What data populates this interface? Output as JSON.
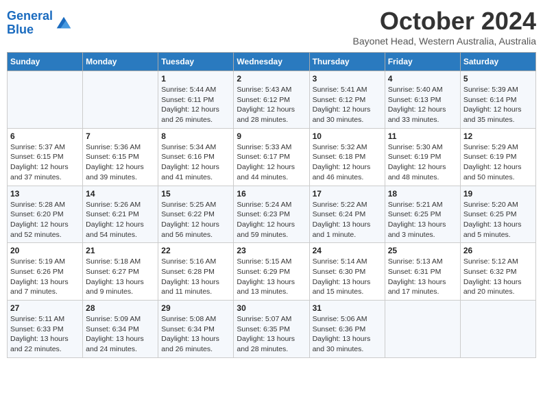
{
  "logo": {
    "line1": "General",
    "line2": "Blue"
  },
  "title": "October 2024",
  "location": "Bayonet Head, Western Australia, Australia",
  "weekdays": [
    "Sunday",
    "Monday",
    "Tuesday",
    "Wednesday",
    "Thursday",
    "Friday",
    "Saturday"
  ],
  "weeks": [
    [
      {
        "day": null,
        "info": null
      },
      {
        "day": null,
        "info": null
      },
      {
        "day": "1",
        "info": "Sunrise: 5:44 AM\nSunset: 6:11 PM\nDaylight: 12 hours and 26 minutes."
      },
      {
        "day": "2",
        "info": "Sunrise: 5:43 AM\nSunset: 6:12 PM\nDaylight: 12 hours and 28 minutes."
      },
      {
        "day": "3",
        "info": "Sunrise: 5:41 AM\nSunset: 6:12 PM\nDaylight: 12 hours and 30 minutes."
      },
      {
        "day": "4",
        "info": "Sunrise: 5:40 AM\nSunset: 6:13 PM\nDaylight: 12 hours and 33 minutes."
      },
      {
        "day": "5",
        "info": "Sunrise: 5:39 AM\nSunset: 6:14 PM\nDaylight: 12 hours and 35 minutes."
      }
    ],
    [
      {
        "day": "6",
        "info": "Sunrise: 5:37 AM\nSunset: 6:15 PM\nDaylight: 12 hours and 37 minutes."
      },
      {
        "day": "7",
        "info": "Sunrise: 5:36 AM\nSunset: 6:15 PM\nDaylight: 12 hours and 39 minutes."
      },
      {
        "day": "8",
        "info": "Sunrise: 5:34 AM\nSunset: 6:16 PM\nDaylight: 12 hours and 41 minutes."
      },
      {
        "day": "9",
        "info": "Sunrise: 5:33 AM\nSunset: 6:17 PM\nDaylight: 12 hours and 44 minutes."
      },
      {
        "day": "10",
        "info": "Sunrise: 5:32 AM\nSunset: 6:18 PM\nDaylight: 12 hours and 46 minutes."
      },
      {
        "day": "11",
        "info": "Sunrise: 5:30 AM\nSunset: 6:19 PM\nDaylight: 12 hours and 48 minutes."
      },
      {
        "day": "12",
        "info": "Sunrise: 5:29 AM\nSunset: 6:19 PM\nDaylight: 12 hours and 50 minutes."
      }
    ],
    [
      {
        "day": "13",
        "info": "Sunrise: 5:28 AM\nSunset: 6:20 PM\nDaylight: 12 hours and 52 minutes."
      },
      {
        "day": "14",
        "info": "Sunrise: 5:26 AM\nSunset: 6:21 PM\nDaylight: 12 hours and 54 minutes."
      },
      {
        "day": "15",
        "info": "Sunrise: 5:25 AM\nSunset: 6:22 PM\nDaylight: 12 hours and 56 minutes."
      },
      {
        "day": "16",
        "info": "Sunrise: 5:24 AM\nSunset: 6:23 PM\nDaylight: 12 hours and 59 minutes."
      },
      {
        "day": "17",
        "info": "Sunrise: 5:22 AM\nSunset: 6:24 PM\nDaylight: 13 hours and 1 minute."
      },
      {
        "day": "18",
        "info": "Sunrise: 5:21 AM\nSunset: 6:25 PM\nDaylight: 13 hours and 3 minutes."
      },
      {
        "day": "19",
        "info": "Sunrise: 5:20 AM\nSunset: 6:25 PM\nDaylight: 13 hours and 5 minutes."
      }
    ],
    [
      {
        "day": "20",
        "info": "Sunrise: 5:19 AM\nSunset: 6:26 PM\nDaylight: 13 hours and 7 minutes."
      },
      {
        "day": "21",
        "info": "Sunrise: 5:18 AM\nSunset: 6:27 PM\nDaylight: 13 hours and 9 minutes."
      },
      {
        "day": "22",
        "info": "Sunrise: 5:16 AM\nSunset: 6:28 PM\nDaylight: 13 hours and 11 minutes."
      },
      {
        "day": "23",
        "info": "Sunrise: 5:15 AM\nSunset: 6:29 PM\nDaylight: 13 hours and 13 minutes."
      },
      {
        "day": "24",
        "info": "Sunrise: 5:14 AM\nSunset: 6:30 PM\nDaylight: 13 hours and 15 minutes."
      },
      {
        "day": "25",
        "info": "Sunrise: 5:13 AM\nSunset: 6:31 PM\nDaylight: 13 hours and 17 minutes."
      },
      {
        "day": "26",
        "info": "Sunrise: 5:12 AM\nSunset: 6:32 PM\nDaylight: 13 hours and 20 minutes."
      }
    ],
    [
      {
        "day": "27",
        "info": "Sunrise: 5:11 AM\nSunset: 6:33 PM\nDaylight: 13 hours and 22 minutes."
      },
      {
        "day": "28",
        "info": "Sunrise: 5:09 AM\nSunset: 6:34 PM\nDaylight: 13 hours and 24 minutes."
      },
      {
        "day": "29",
        "info": "Sunrise: 5:08 AM\nSunset: 6:34 PM\nDaylight: 13 hours and 26 minutes."
      },
      {
        "day": "30",
        "info": "Sunrise: 5:07 AM\nSunset: 6:35 PM\nDaylight: 13 hours and 28 minutes."
      },
      {
        "day": "31",
        "info": "Sunrise: 5:06 AM\nSunset: 6:36 PM\nDaylight: 13 hours and 30 minutes."
      },
      {
        "day": null,
        "info": null
      },
      {
        "day": null,
        "info": null
      }
    ]
  ]
}
